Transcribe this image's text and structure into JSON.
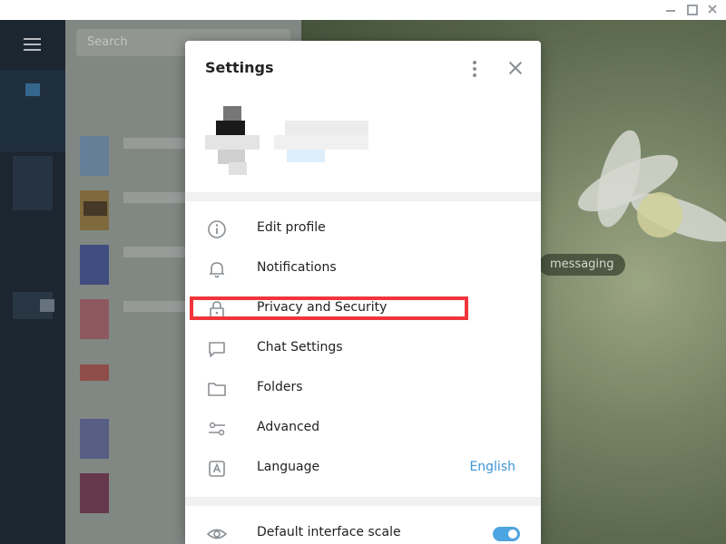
{
  "window": {
    "controls": [
      "minimize",
      "maximize",
      "close"
    ]
  },
  "sidebar": {
    "search_placeholder": "Search"
  },
  "chat_background": {
    "bubble_text": "messaging"
  },
  "settings": {
    "title": "Settings",
    "menu": [
      {
        "label": "Edit profile",
        "icon": "info-icon"
      },
      {
        "label": "Notifications",
        "icon": "bell-icon"
      },
      {
        "label": "Privacy and Security",
        "icon": "lock-icon"
      },
      {
        "label": "Chat Settings",
        "icon": "chat-icon"
      },
      {
        "label": "Folders",
        "icon": "folder-icon"
      },
      {
        "label": "Advanced",
        "icon": "sliders-icon"
      },
      {
        "label": "Language",
        "icon": "language-icon",
        "value": "English"
      }
    ],
    "scale": {
      "label": "Default interface scale",
      "icon": "eye-icon",
      "enabled": true
    }
  },
  "colors": {
    "accent": "#3a95d5",
    "highlight_box": "#f0353b",
    "toggle_on": "#4ea4e0"
  }
}
